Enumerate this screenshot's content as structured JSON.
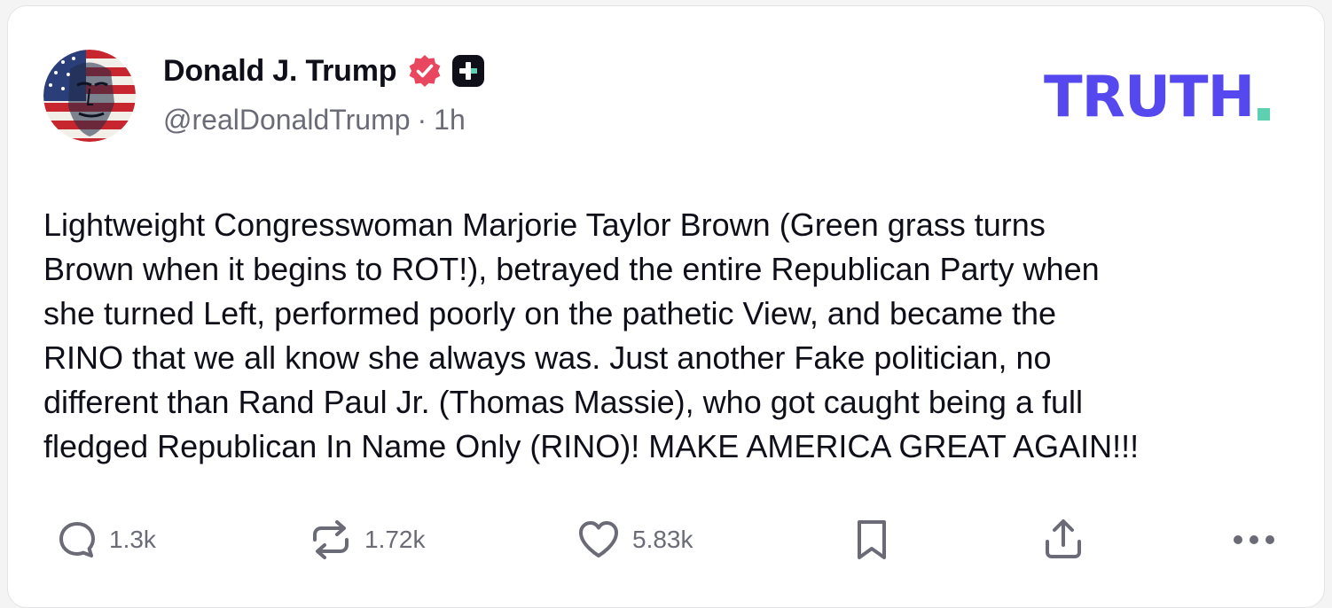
{
  "author": {
    "display_name": "Donald J. Trump",
    "handle": "@realDonaldTrump",
    "separator": "·",
    "time_ago": "1h",
    "verified_icon": "verified-badge-icon",
    "plus_icon": "plus-badge-icon"
  },
  "brand": {
    "logo_text": "TRUTH",
    "logo_color": "#5448EE",
    "logo_dot_color": "#5ED0B2"
  },
  "post": {
    "lines": [
      "Lightweight Congresswoman Marjorie Taylor Brown (Green grass turns",
      "Brown when it begins to ROT!), betrayed the entire Republican Party when",
      "she turned Left, performed poorly on the pathetic View, and became the",
      "RINO that we all know she always was. Just another Fake politician, no",
      "different than Rand Paul Jr. (Thomas Massie), who got caught being a full",
      "fledged Republican In Name Only (RINO)! MAKE AMERICA GREAT AGAIN!!!"
    ]
  },
  "actions": {
    "reply": {
      "icon": "reply-icon",
      "count": "1.3k"
    },
    "retruth": {
      "icon": "retruth-icon",
      "count": "1.72k"
    },
    "like": {
      "icon": "heart-icon",
      "count": "5.83k"
    },
    "bookmark": {
      "icon": "bookmark-icon"
    },
    "share": {
      "icon": "share-icon"
    },
    "more": {
      "icon": "more-icon"
    }
  },
  "colors": {
    "text_primary": "#0F0F1A",
    "text_secondary": "#6B6B78",
    "verified_badge": "#E8475F",
    "plus_badge": "#0F0F1A"
  }
}
